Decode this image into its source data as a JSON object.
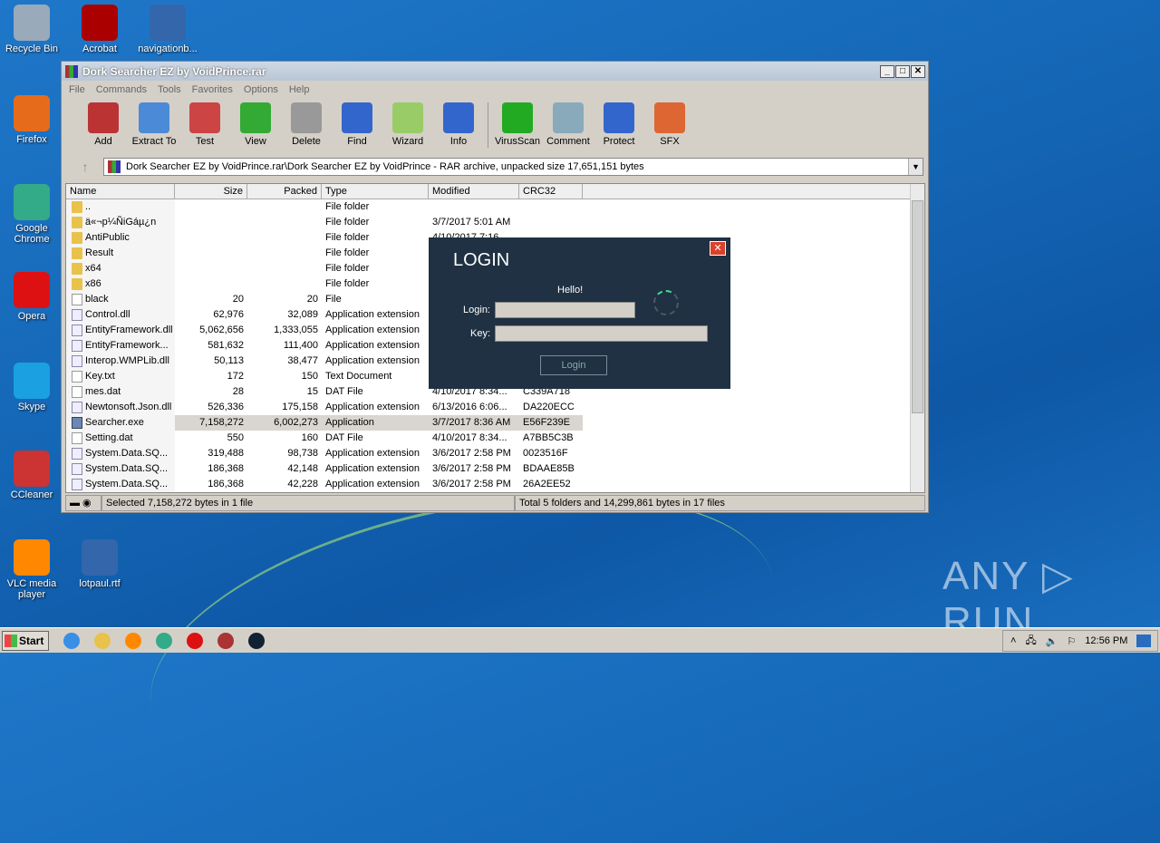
{
  "desktop": {
    "icons": [
      {
        "label": "Recycle Bin",
        "color": "#9ab"
      },
      {
        "label": "Acrobat",
        "color": "#a00"
      },
      {
        "label": "navigationb...",
        "color": "#36a"
      },
      {
        "label": "Firefox",
        "color": "#e66b1a"
      },
      {
        "label": "Google Chrome",
        "color": "#3a8"
      },
      {
        "label": "Opera",
        "color": "#d11"
      },
      {
        "label": "Skype",
        "color": "#1ba0e1"
      },
      {
        "label": "CCleaner",
        "color": "#c33"
      },
      {
        "label": "VLC media player",
        "color": "#f80"
      },
      {
        "label": "lotpaul.rtf",
        "color": "#36a"
      }
    ]
  },
  "window": {
    "title": "Dork Searcher EZ by VoidPrince.rar",
    "menu": [
      "File",
      "Commands",
      "Tools",
      "Favorites",
      "Options",
      "Help"
    ],
    "toolbar": [
      {
        "label": "Add",
        "color": "#b33"
      },
      {
        "label": "Extract To",
        "color": "#4a8ad6"
      },
      {
        "label": "Test",
        "color": "#c44"
      },
      {
        "label": "View",
        "color": "#3a3"
      },
      {
        "label": "Delete",
        "color": "#999"
      },
      {
        "label": "Find",
        "color": "#36c"
      },
      {
        "label": "Wizard",
        "color": "#9c6"
      },
      {
        "label": "Info",
        "color": "#36c"
      },
      {
        "label": "VirusScan",
        "color": "#2a2"
      },
      {
        "label": "Comment",
        "color": "#8ab"
      },
      {
        "label": "Protect",
        "color": "#36c"
      },
      {
        "label": "SFX",
        "color": "#d63"
      }
    ],
    "address": "Dork Searcher EZ by VoidPrince.rar\\Dork Searcher EZ by VoidPrince - RAR archive, unpacked size 17,651,151 bytes",
    "columns": [
      "Name",
      "Size",
      "Packed",
      "Type",
      "Modified",
      "CRC32"
    ],
    "files": [
      {
        "name": "..",
        "size": "",
        "packed": "",
        "type": "File folder",
        "modified": "",
        "crc": "",
        "icon": "folder"
      },
      {
        "name": "ä«¬p¼ÑiGáµ¿n",
        "size": "",
        "packed": "",
        "type": "File folder",
        "modified": "3/7/2017 5:01 AM",
        "crc": "",
        "icon": "folder"
      },
      {
        "name": "AntiPublic",
        "size": "",
        "packed": "",
        "type": "File folder",
        "modified": "4/10/2017 7:16...",
        "crc": "",
        "icon": "folder"
      },
      {
        "name": "Result",
        "size": "",
        "packed": "",
        "type": "File folder",
        "modified": "",
        "crc": "",
        "icon": "folder"
      },
      {
        "name": "x64",
        "size": "",
        "packed": "",
        "type": "File folder",
        "modified": "",
        "crc": "",
        "icon": "folder"
      },
      {
        "name": "x86",
        "size": "",
        "packed": "",
        "type": "File folder",
        "modified": "",
        "crc": "",
        "icon": "folder"
      },
      {
        "name": "black",
        "size": "20",
        "packed": "20",
        "type": "File",
        "modified": "",
        "crc": "",
        "icon": "file"
      },
      {
        "name": "Control.dll",
        "size": "62,976",
        "packed": "32,089",
        "type": "Application extension",
        "modified": "",
        "crc": "",
        "icon": "dll"
      },
      {
        "name": "EntityFramework.dll",
        "size": "5,062,656",
        "packed": "1,333,055",
        "type": "Application extension",
        "modified": "",
        "crc": "",
        "icon": "dll"
      },
      {
        "name": "EntityFramework...",
        "size": "581,632",
        "packed": "111,400",
        "type": "Application extension",
        "modified": "",
        "crc": "",
        "icon": "dll"
      },
      {
        "name": "Interop.WMPLib.dll",
        "size": "50,113",
        "packed": "38,477",
        "type": "Application extension",
        "modified": "",
        "crc": "",
        "icon": "dll"
      },
      {
        "name": "Key.txt",
        "size": "172",
        "packed": "150",
        "type": "Text Document",
        "modified": "",
        "crc": "",
        "icon": "file"
      },
      {
        "name": "mes.dat",
        "size": "28",
        "packed": "15",
        "type": "DAT File",
        "modified": "4/10/2017 8:34...",
        "crc": "C339A718",
        "icon": "file"
      },
      {
        "name": "Newtonsoft.Json.dll",
        "size": "526,336",
        "packed": "175,158",
        "type": "Application extension",
        "modified": "6/13/2016 6:06...",
        "crc": "DA220ECC",
        "icon": "dll"
      },
      {
        "name": "Searcher.exe",
        "size": "7,158,272",
        "packed": "6,002,273",
        "type": "Application",
        "modified": "3/7/2017 8:36 AM",
        "crc": "E56F239E",
        "icon": "exe",
        "selected": true
      },
      {
        "name": "Setting.dat",
        "size": "550",
        "packed": "160",
        "type": "DAT File",
        "modified": "4/10/2017 8:34...",
        "crc": "A7BB5C3B",
        "icon": "file"
      },
      {
        "name": "System.Data.SQ...",
        "size": "319,488",
        "packed": "98,738",
        "type": "Application extension",
        "modified": "3/6/2017 2:58 PM",
        "crc": "0023516F",
        "icon": "dll"
      },
      {
        "name": "System.Data.SQ...",
        "size": "186,368",
        "packed": "42,148",
        "type": "Application extension",
        "modified": "3/6/2017 2:58 PM",
        "crc": "BDAAE85B",
        "icon": "dll"
      },
      {
        "name": "System.Data.SQ...",
        "size": "186,368",
        "packed": "42,228",
        "type": "Application extension",
        "modified": "3/6/2017 2:58 PM",
        "crc": "26A2EE52",
        "icon": "dll"
      }
    ],
    "status_left": "Selected 7,158,272 bytes in 1 file",
    "status_right": "Total 5 folders and 14,299,861 bytes in 17 files"
  },
  "login": {
    "title": "LOGIN",
    "close": "✕",
    "greeting": "Hello!",
    "login_label": "Login:",
    "key_label": "Key:",
    "login_value": "",
    "key_value": "",
    "button": "Login"
  },
  "taskbar": {
    "start": "Start",
    "apps": [
      {
        "name": "ie",
        "color": "#3a8ee6"
      },
      {
        "name": "explorer",
        "color": "#e8c24a"
      },
      {
        "name": "media-player",
        "color": "#f80"
      },
      {
        "name": "chrome",
        "color": "#3a8"
      },
      {
        "name": "opera",
        "color": "#d11"
      },
      {
        "name": "winrar",
        "color": "#a33"
      },
      {
        "name": "console",
        "color": "#123"
      }
    ],
    "clock": "12:56 PM"
  },
  "watermark": "ANY ▷ RUN"
}
